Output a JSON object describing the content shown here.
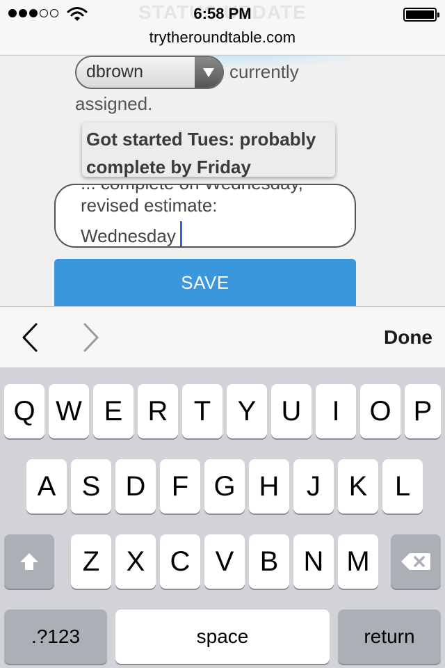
{
  "status_bar": {
    "time": "6:58 PM",
    "signal_bars_filled": 3,
    "signal_bars_total": 5,
    "battery_level": 1.0
  },
  "browser": {
    "url": "trytheroundtable.com",
    "ghost_header": "STATUS UPDATE"
  },
  "form": {
    "assignee_value": "dbrown",
    "assigned_text_line1": "currently",
    "assigned_text_line2": "assigned.",
    "tooltip_line1": "Got started Tues: probably",
    "tooltip_line2": "complete by Friday",
    "textarea_partial": "... complete on Wednesday,",
    "textarea_line1": "revised estimate:",
    "textarea_line2": "Wednesday",
    "save_label": "SAVE"
  },
  "accessory": {
    "done_label": "Done",
    "prev_icon": "chevron-left-icon",
    "next_icon": "chevron-right-icon"
  },
  "keyboard": {
    "row1": [
      "Q",
      "W",
      "E",
      "R",
      "T",
      "Y",
      "U",
      "I",
      "O",
      "P"
    ],
    "row2": [
      "A",
      "S",
      "D",
      "F",
      "G",
      "H",
      "J",
      "K",
      "L"
    ],
    "row3": [
      "Z",
      "X",
      "C",
      "V",
      "B",
      "N",
      "M"
    ],
    "numbers_label": ".?123",
    "space_label": "space",
    "return_label": "return",
    "shift_icon": "shift-arrow-icon",
    "backspace_icon": "backspace-icon"
  },
  "colors": {
    "save_button": "#3a97dc",
    "caret": "#3a62d8",
    "keyboard_bg": "#d1d3d8"
  }
}
